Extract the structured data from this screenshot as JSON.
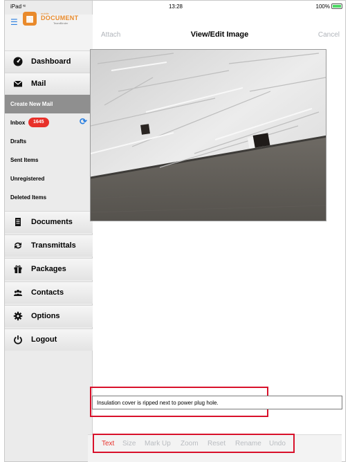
{
  "status_bar": {
    "device": "iPad",
    "time": "13:28",
    "battery": "100%",
    "battery_level": 1.0
  },
  "sidebar": {
    "logo": {
      "brand_small": "mobile",
      "brand": "DOCUMENT",
      "brand_sub": "TeamBinder"
    },
    "mail_items": [
      {
        "label": "Create New Mail"
      },
      {
        "label": "Inbox",
        "badge": "1645"
      },
      {
        "label": "Drafts"
      },
      {
        "label": "Sent Items"
      },
      {
        "label": "Unregistered"
      },
      {
        "label": "Deleted Items"
      }
    ],
    "main_items": {
      "dashboard": "Dashboard",
      "mail": "Mail",
      "documents": "Documents",
      "transmittals": "Transmittals",
      "packages": "Packages",
      "contacts": "Contacts",
      "options": "Options",
      "logout": "Logout"
    },
    "active_item": "Create New Mail"
  },
  "header": {
    "attach": "Attach",
    "title": "View/Edit Image",
    "cancel": "Cancel"
  },
  "caption": {
    "text": "Insulation cover is ripped next to power plug hole."
  },
  "toolbar": {
    "items": [
      "Text",
      "Size",
      "Mark Up",
      "Zoom",
      "Reset",
      "Rename",
      "Undo"
    ],
    "active": "Text"
  },
  "colors": {
    "accent_red": "#e8302a",
    "link_blue": "#2a7fe0",
    "brand_orange": "#e98a2b",
    "highlight_red": "#d8102a"
  }
}
